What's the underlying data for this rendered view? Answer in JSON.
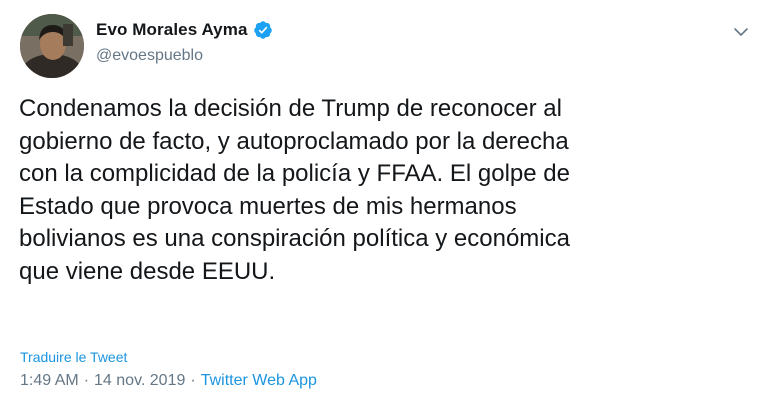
{
  "author": {
    "display_name": "Evo Morales Ayma",
    "handle": "@evoespueblo",
    "verified": true,
    "verified_color": "#1da1f2"
  },
  "tweet": {
    "lines": [
      "Condenamos la decisión de Trump de reconocer al",
      "gobierno de facto, y autoproclamado por la derecha",
      "con la complicidad de la policía y FFAA. El golpe de",
      "Estado que provoca muertes de mis hermanos",
      "bolivianos es una conspiración política y económica",
      "que viene desde EEUU."
    ]
  },
  "translate_label": "Traduire le Tweet",
  "meta": {
    "time": "1:49 AM",
    "separator": "·",
    "date": "14 nov. 2019",
    "source": "Twitter Web App"
  },
  "icons": {
    "verified": "verified-badge-icon",
    "menu": "chevron-down-icon",
    "avatar": "profile-photo"
  },
  "colors": {
    "link": "#1b95e0",
    "secondary_text": "#657786",
    "primary_text": "#14171a"
  }
}
